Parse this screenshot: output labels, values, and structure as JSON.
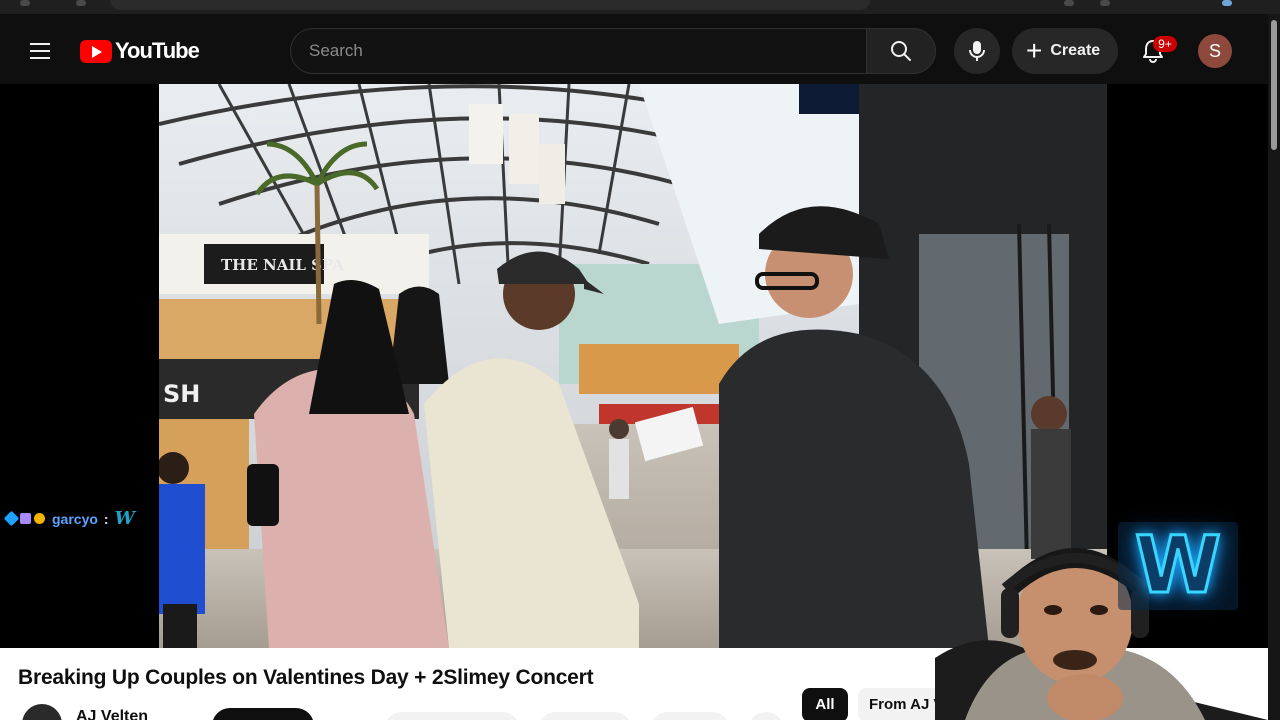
{
  "header": {
    "logo_text": "YouTube",
    "search_placeholder": "Search",
    "create_label": "Create",
    "notification_count": "9+",
    "avatar_initial": "S"
  },
  "chat_overlay": {
    "username": "garcyo",
    "separator": ":",
    "message": "W"
  },
  "video": {
    "title": "Breaking Up Couples on Valentines Day + 2Slimey Concert",
    "channel_name": "AJ Velten"
  },
  "filter_chips": [
    {
      "label": "All",
      "selected": true
    },
    {
      "label": "From AJ Velten",
      "selected": false
    }
  ],
  "streamer_overlay": {
    "emblem_letter": "W",
    "emblem_color": "#38d6ff"
  },
  "colors": {
    "brand_red": "#ff0000",
    "badge_red": "#cc0000",
    "background": "#0f0f0f"
  }
}
